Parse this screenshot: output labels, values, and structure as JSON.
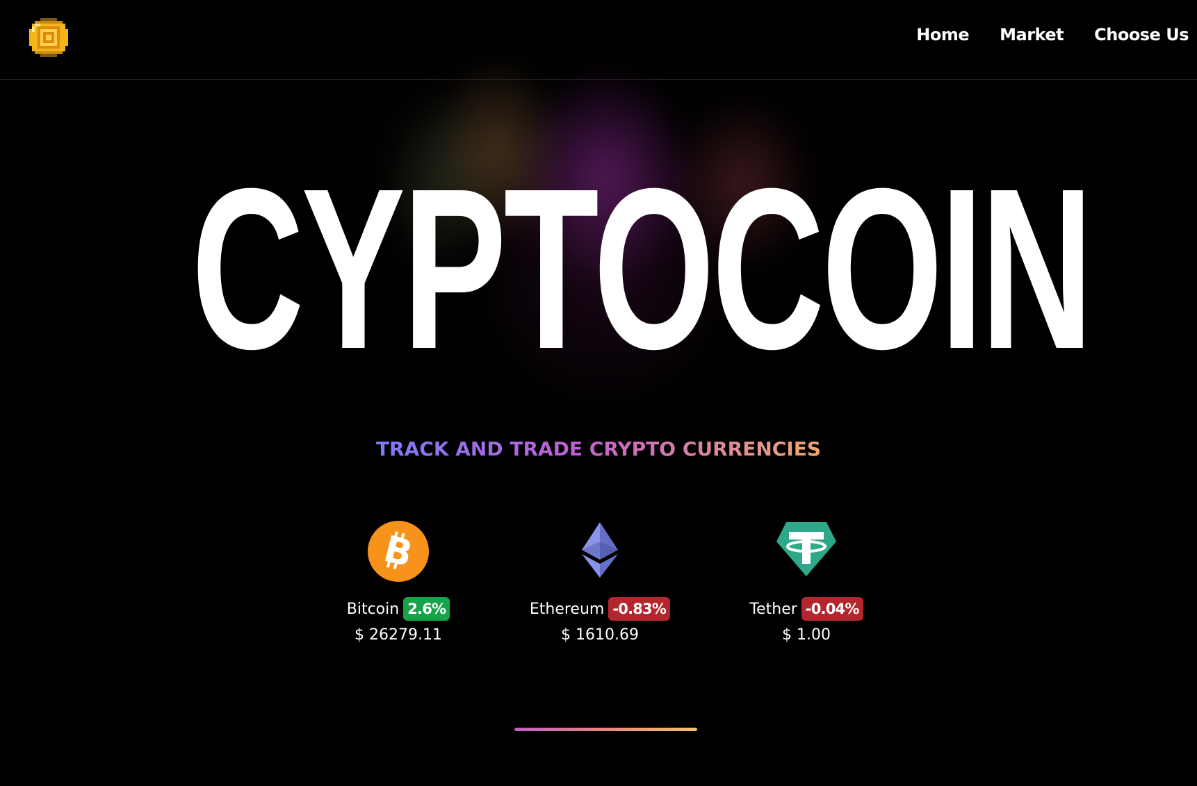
{
  "header": {
    "logo_icon": "pixel-coin-icon",
    "nav": [
      {
        "label": "Home"
      },
      {
        "label": "Market"
      },
      {
        "label": "Choose Us"
      }
    ]
  },
  "hero": {
    "title": "CYPTOCOIN",
    "tagline": "TRACK AND TRADE CRYPTO CURRENCIES"
  },
  "coins": [
    {
      "name": "Bitcoin",
      "change": "2.6%",
      "trend": "up",
      "price": "$ 26279.11",
      "icon": "bitcoin-icon",
      "color": "#f7931a"
    },
    {
      "name": "Ethereum",
      "change": "-0.83%",
      "trend": "down",
      "price": "$ 1610.69",
      "icon": "ethereum-icon",
      "color": "#7b86e0"
    },
    {
      "name": "Tether",
      "change": "-0.04%",
      "trend": "down",
      "price": "$ 1.00",
      "icon": "tether-icon",
      "color": "#2fa88a"
    }
  ],
  "colors": {
    "up": "#17a34a",
    "down": "#b3262d",
    "gradient_start": "#7b7bff",
    "gradient_mid": "#c060d0",
    "gradient_end": "#f0a870"
  }
}
